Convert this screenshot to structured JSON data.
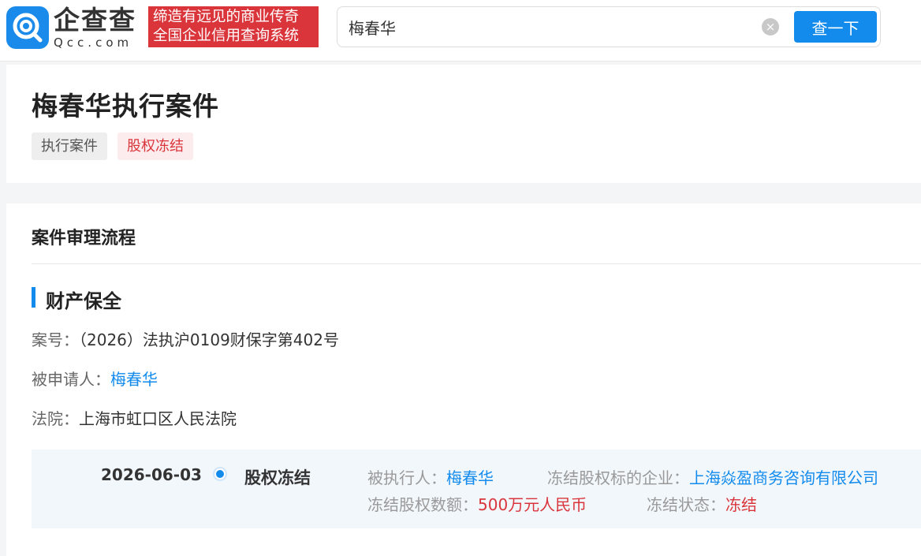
{
  "header": {
    "logo_cn": "企查查",
    "logo_en": "Qcc.com",
    "slogan_line1": "缔造有远见的商业传奇",
    "slogan_line2": "全国企业信用查询系统",
    "search_value": "梅春华",
    "clear_icon": "clear-icon",
    "search_button": "查一下"
  },
  "title_card": {
    "title": "梅春华执行案件",
    "tags": [
      "执行案件",
      "股权冻结"
    ]
  },
  "process": {
    "section_title": "案件审理流程",
    "sub_title": "财产保全",
    "case_no_label": "案号：",
    "case_no_value": "（2026）法执沪0109财保字第402号",
    "respondent_label": "被申请人：",
    "respondent_value": "梅春华",
    "court_label": "法院：",
    "court_value": "上海市虹口区人民法院",
    "timeline": {
      "date": "2026-06-03",
      "event": "股权冻结",
      "executee_label": "被执行人：",
      "executee_value": "梅春华",
      "company_label": "冻结股权标的企业：",
      "company_value": "上海焱盈商务咨询有限公司",
      "amount_label": "冻结股权数额：",
      "amount_value": "500万元人民币",
      "status_label": "冻结状态：",
      "status_value": "冻结"
    }
  },
  "colors": {
    "accent": "#128bed",
    "brand_red": "#d9353b",
    "timeline_bg": "#f2f7fc"
  }
}
